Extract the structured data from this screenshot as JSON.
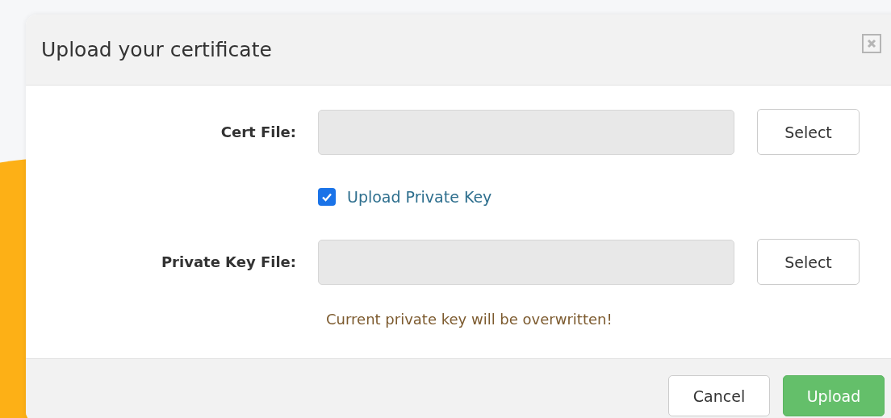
{
  "dialog": {
    "title": "Upload your certificate",
    "cert_file": {
      "label": "Cert File:",
      "select_button": "Select"
    },
    "upload_private_key": {
      "label": "Upload Private Key",
      "checked": true
    },
    "private_key_file": {
      "label": "Private Key File:",
      "select_button": "Select"
    },
    "warning": "Current private key will be overwritten!",
    "buttons": {
      "cancel": "Cancel",
      "upload": "Upload"
    }
  }
}
